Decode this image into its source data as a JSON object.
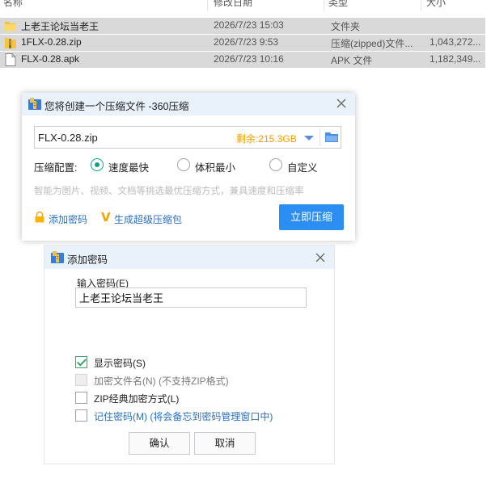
{
  "explorer": {
    "columns": [
      "名称",
      "修改日期",
      "类型",
      "大小"
    ],
    "files": [
      {
        "name": "上老王论坛当老王",
        "date": "2026/7/23 15:03",
        "type": "文件夹",
        "size": "",
        "icon": "folder-icon"
      },
      {
        "name": "1FLX-0.28.zip",
        "date": "2026/7/23 9:53",
        "type": "压缩(zipped)文件...",
        "size": "1,043,272...",
        "icon": "zip-icon"
      },
      {
        "name": "FLX-0.28.apk",
        "date": "2026/7/23 10:16",
        "type": "APK 文件",
        "size": "1,182,349...",
        "icon": "file-icon"
      }
    ]
  },
  "compress_dialog": {
    "title": "您将创建一个压缩文件 -360压缩",
    "filename": "FLX-0.28.zip",
    "free_space": "剩余:215.3GB",
    "config_label": "压缩配置:",
    "options": [
      {
        "label": "速度最快",
        "checked": true
      },
      {
        "label": "体积最小",
        "checked": false
      },
      {
        "label": "自定义",
        "checked": false
      }
    ],
    "hint": "智能为图片、视频、文档等挑选最优压缩方式，兼具速度和压缩率",
    "add_password": "添加密码",
    "create_sfx": "生成超级压缩包",
    "compress_button": "立即压缩",
    "colors": {
      "accent": "#2b8ef0",
      "space": "#f49b00",
      "radio": "#14a085"
    }
  },
  "password_dialog": {
    "title": "添加密码",
    "input_label": "输入密码(E)",
    "password_value": "上老王论坛当老王",
    "checkboxes": [
      {
        "label": "显示密码(S)",
        "checked": true,
        "disabled": false,
        "style": "normal"
      },
      {
        "label": "加密文件名(N) (不支持ZIP格式)",
        "checked": false,
        "disabled": true,
        "style": "normal"
      },
      {
        "label": "ZIP经典加密方式(L)",
        "checked": false,
        "disabled": false,
        "style": "normal"
      },
      {
        "label": "记住密码(M) (将会备忘到密码管理窗口中)",
        "checked": false,
        "disabled": false,
        "style": "blue"
      }
    ],
    "ok_button": "确认",
    "cancel_button": "取消"
  }
}
